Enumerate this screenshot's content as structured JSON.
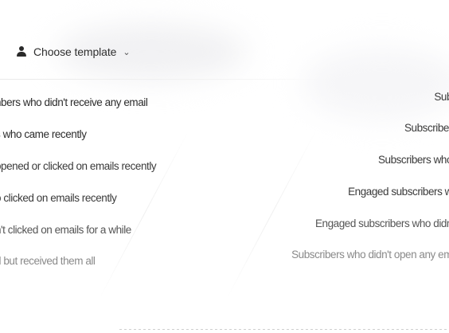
{
  "template_picker": {
    "label": "Choose template",
    "chevron": "⌄",
    "icon": "person-icon"
  },
  "segments_left": [
    "nbers who didn't receive any email",
    "s who came recently",
    "opened or clicked on emails recently",
    "o clicked on emails recently",
    "n't clicked on emails for a while",
    "d but received them all"
  ],
  "segments_right": [
    "Sub",
    "Subscriber",
    "Subscribers who",
    "Engaged subscribers w",
    "Engaged subscribers who didn",
    "Subscribers who didn't open any em"
  ]
}
